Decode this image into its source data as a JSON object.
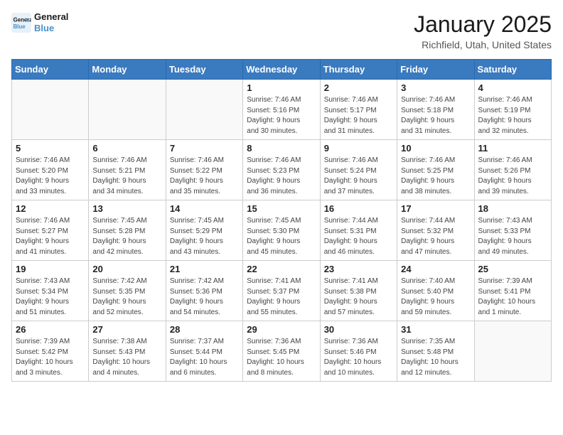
{
  "header": {
    "logo_line1": "General",
    "logo_line2": "Blue",
    "month": "January 2025",
    "location": "Richfield, Utah, United States"
  },
  "days_of_week": [
    "Sunday",
    "Monday",
    "Tuesday",
    "Wednesday",
    "Thursday",
    "Friday",
    "Saturday"
  ],
  "weeks": [
    [
      {
        "day": "",
        "detail": ""
      },
      {
        "day": "",
        "detail": ""
      },
      {
        "day": "",
        "detail": ""
      },
      {
        "day": "1",
        "detail": "Sunrise: 7:46 AM\nSunset: 5:16 PM\nDaylight: 9 hours\nand 30 minutes."
      },
      {
        "day": "2",
        "detail": "Sunrise: 7:46 AM\nSunset: 5:17 PM\nDaylight: 9 hours\nand 31 minutes."
      },
      {
        "day": "3",
        "detail": "Sunrise: 7:46 AM\nSunset: 5:18 PM\nDaylight: 9 hours\nand 31 minutes."
      },
      {
        "day": "4",
        "detail": "Sunrise: 7:46 AM\nSunset: 5:19 PM\nDaylight: 9 hours\nand 32 minutes."
      }
    ],
    [
      {
        "day": "5",
        "detail": "Sunrise: 7:46 AM\nSunset: 5:20 PM\nDaylight: 9 hours\nand 33 minutes."
      },
      {
        "day": "6",
        "detail": "Sunrise: 7:46 AM\nSunset: 5:21 PM\nDaylight: 9 hours\nand 34 minutes."
      },
      {
        "day": "7",
        "detail": "Sunrise: 7:46 AM\nSunset: 5:22 PM\nDaylight: 9 hours\nand 35 minutes."
      },
      {
        "day": "8",
        "detail": "Sunrise: 7:46 AM\nSunset: 5:23 PM\nDaylight: 9 hours\nand 36 minutes."
      },
      {
        "day": "9",
        "detail": "Sunrise: 7:46 AM\nSunset: 5:24 PM\nDaylight: 9 hours\nand 37 minutes."
      },
      {
        "day": "10",
        "detail": "Sunrise: 7:46 AM\nSunset: 5:25 PM\nDaylight: 9 hours\nand 38 minutes."
      },
      {
        "day": "11",
        "detail": "Sunrise: 7:46 AM\nSunset: 5:26 PM\nDaylight: 9 hours\nand 39 minutes."
      }
    ],
    [
      {
        "day": "12",
        "detail": "Sunrise: 7:46 AM\nSunset: 5:27 PM\nDaylight: 9 hours\nand 41 minutes."
      },
      {
        "day": "13",
        "detail": "Sunrise: 7:45 AM\nSunset: 5:28 PM\nDaylight: 9 hours\nand 42 minutes."
      },
      {
        "day": "14",
        "detail": "Sunrise: 7:45 AM\nSunset: 5:29 PM\nDaylight: 9 hours\nand 43 minutes."
      },
      {
        "day": "15",
        "detail": "Sunrise: 7:45 AM\nSunset: 5:30 PM\nDaylight: 9 hours\nand 45 minutes."
      },
      {
        "day": "16",
        "detail": "Sunrise: 7:44 AM\nSunset: 5:31 PM\nDaylight: 9 hours\nand 46 minutes."
      },
      {
        "day": "17",
        "detail": "Sunrise: 7:44 AM\nSunset: 5:32 PM\nDaylight: 9 hours\nand 47 minutes."
      },
      {
        "day": "18",
        "detail": "Sunrise: 7:43 AM\nSunset: 5:33 PM\nDaylight: 9 hours\nand 49 minutes."
      }
    ],
    [
      {
        "day": "19",
        "detail": "Sunrise: 7:43 AM\nSunset: 5:34 PM\nDaylight: 9 hours\nand 51 minutes."
      },
      {
        "day": "20",
        "detail": "Sunrise: 7:42 AM\nSunset: 5:35 PM\nDaylight: 9 hours\nand 52 minutes."
      },
      {
        "day": "21",
        "detail": "Sunrise: 7:42 AM\nSunset: 5:36 PM\nDaylight: 9 hours\nand 54 minutes."
      },
      {
        "day": "22",
        "detail": "Sunrise: 7:41 AM\nSunset: 5:37 PM\nDaylight: 9 hours\nand 55 minutes."
      },
      {
        "day": "23",
        "detail": "Sunrise: 7:41 AM\nSunset: 5:38 PM\nDaylight: 9 hours\nand 57 minutes."
      },
      {
        "day": "24",
        "detail": "Sunrise: 7:40 AM\nSunset: 5:40 PM\nDaylight: 9 hours\nand 59 minutes."
      },
      {
        "day": "25",
        "detail": "Sunrise: 7:39 AM\nSunset: 5:41 PM\nDaylight: 10 hours\nand 1 minute."
      }
    ],
    [
      {
        "day": "26",
        "detail": "Sunrise: 7:39 AM\nSunset: 5:42 PM\nDaylight: 10 hours\nand 3 minutes."
      },
      {
        "day": "27",
        "detail": "Sunrise: 7:38 AM\nSunset: 5:43 PM\nDaylight: 10 hours\nand 4 minutes."
      },
      {
        "day": "28",
        "detail": "Sunrise: 7:37 AM\nSunset: 5:44 PM\nDaylight: 10 hours\nand 6 minutes."
      },
      {
        "day": "29",
        "detail": "Sunrise: 7:36 AM\nSunset: 5:45 PM\nDaylight: 10 hours\nand 8 minutes."
      },
      {
        "day": "30",
        "detail": "Sunrise: 7:36 AM\nSunset: 5:46 PM\nDaylight: 10 hours\nand 10 minutes."
      },
      {
        "day": "31",
        "detail": "Sunrise: 7:35 AM\nSunset: 5:48 PM\nDaylight: 10 hours\nand 12 minutes."
      },
      {
        "day": "",
        "detail": ""
      }
    ]
  ]
}
